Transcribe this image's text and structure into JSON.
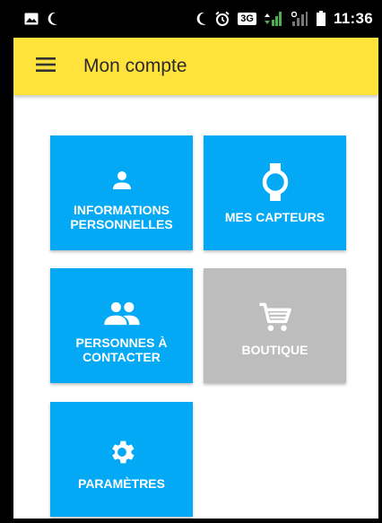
{
  "status_bar": {
    "time": "11:36",
    "network": "3G",
    "icons": [
      "image-icon",
      "moon-icon",
      "moon-icon",
      "alarm-icon",
      "signal-icon",
      "signal-icon",
      "battery-icon"
    ]
  },
  "app_bar": {
    "title": "Mon compte",
    "background": "#ffe33b",
    "menu_icon": "hamburger-menu-icon"
  },
  "tiles": [
    {
      "label": "INFORMATIONS\nPERSONNELLES",
      "icon": "person-icon",
      "enabled": true
    },
    {
      "label": "MES CAPTEURS",
      "icon": "watch-icon",
      "enabled": true
    },
    {
      "label": "PERSONNES À\nCONTACTER",
      "icon": "people-icon",
      "enabled": true
    },
    {
      "label": "BOUTIQUE",
      "icon": "cart-icon",
      "enabled": false
    },
    {
      "label": "PARAMÈTRES",
      "icon": "gear-icon",
      "enabled": true
    }
  ],
  "colors": {
    "tile_active": "#03a9f4",
    "tile_disabled": "#bdbdbd"
  }
}
